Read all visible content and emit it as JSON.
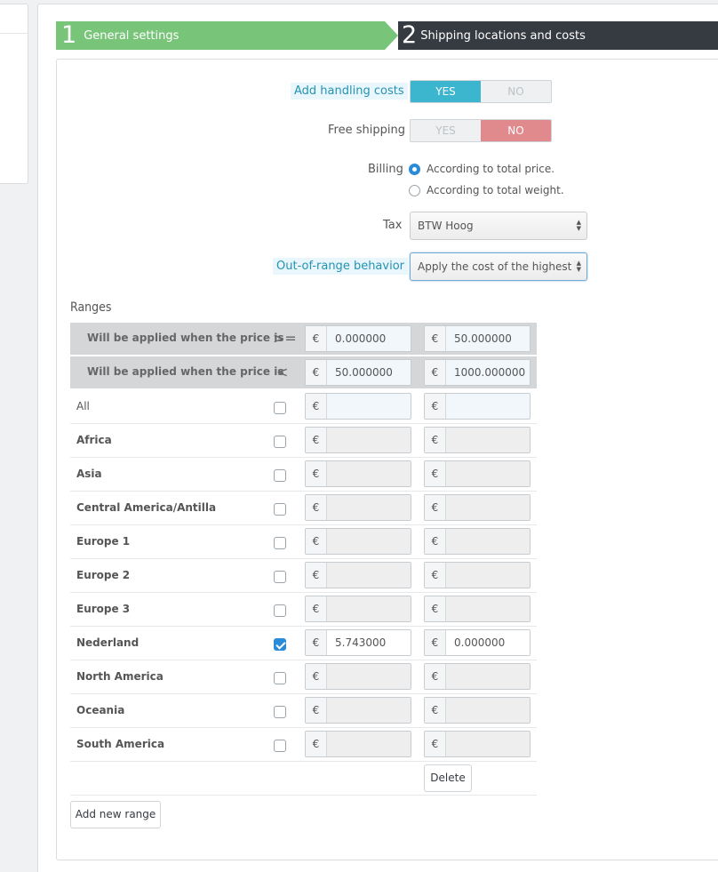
{
  "steps": [
    {
      "number": "1",
      "label": "General settings"
    },
    {
      "number": "2",
      "label": "Shipping locations and costs"
    }
  ],
  "handling": {
    "label": "Add handling costs",
    "yes": "YES",
    "no": "NO",
    "value": "YES"
  },
  "free_shipping": {
    "label": "Free shipping",
    "yes": "YES",
    "no": "NO",
    "value": "NO"
  },
  "billing": {
    "label": "Billing",
    "options": [
      "According to total price.",
      "According to total weight."
    ],
    "selected": "According to total price."
  },
  "tax": {
    "label": "Tax",
    "value": "BTW Hoog"
  },
  "out_of_range": {
    "label": "Out-of-range behavior",
    "value": "Apply the cost of the highest d"
  },
  "ranges": {
    "title": "Ranges",
    "currency": "€",
    "header_rows": [
      {
        "label": "Will be applied when the price is",
        "operator": ">=",
        "values": [
          "0.000000",
          "50.000000"
        ]
      },
      {
        "label": "Will be applied when the price is",
        "operator": "<",
        "values": [
          "50.000000",
          "1000.000000"
        ]
      }
    ],
    "zones": [
      {
        "name": "All",
        "checked": false,
        "values": [
          "",
          ""
        ]
      },
      {
        "name": "Africa",
        "checked": false,
        "values": [
          "",
          ""
        ]
      },
      {
        "name": "Asia",
        "checked": false,
        "values": [
          "",
          ""
        ]
      },
      {
        "name": "Central America/Antilla",
        "checked": false,
        "values": [
          "",
          ""
        ]
      },
      {
        "name": "Europe 1",
        "checked": false,
        "values": [
          "",
          ""
        ]
      },
      {
        "name": "Europe 2",
        "checked": false,
        "values": [
          "",
          ""
        ]
      },
      {
        "name": "Europe 3",
        "checked": false,
        "values": [
          "",
          ""
        ]
      },
      {
        "name": "Nederland",
        "checked": true,
        "values": [
          "5.743000",
          "0.000000"
        ]
      },
      {
        "name": "North America",
        "checked": false,
        "values": [
          "",
          ""
        ]
      },
      {
        "name": "Oceania",
        "checked": false,
        "values": [
          "",
          ""
        ]
      },
      {
        "name": "South America",
        "checked": false,
        "values": [
          "",
          ""
        ]
      }
    ],
    "delete_label": "Delete",
    "add_label": "Add new range"
  }
}
